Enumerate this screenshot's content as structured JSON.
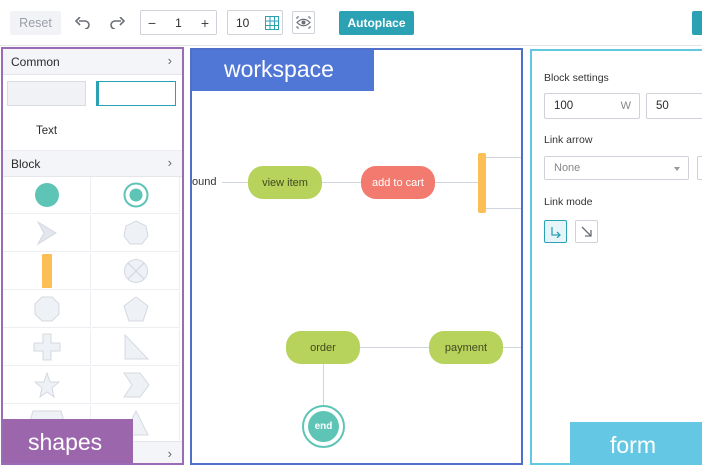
{
  "toolbar": {
    "reset_label": "Reset",
    "undo_icon": "undo-icon",
    "redo_icon": "redo-icon",
    "scale_minus": "−",
    "scale_value": "1",
    "scale_plus": "+",
    "grid_value": "10",
    "grid_icon": "grid-icon",
    "preview_icon": "eye-icon",
    "autoplace_label": "Autoplace"
  },
  "shapes_panel": {
    "tag": "shapes",
    "common_header": "Common",
    "text_item": "Text",
    "block_header": "Block",
    "chevron": "›"
  },
  "workspace": {
    "tag": "workspace",
    "nodes": {
      "found": "ound",
      "view_item": "view item",
      "add_to_cart": "add to cart",
      "order": "order",
      "payment": "payment",
      "end": "end"
    }
  },
  "form": {
    "tag": "form",
    "block_settings_label": "Block settings",
    "width_value": "100",
    "width_suffix": "W",
    "height_value": "50",
    "link_arrow_label": "Link arrow",
    "link_arrow_value": "None",
    "link_mode_label": "Link mode"
  },
  "colors": {
    "accent": "#2aa2b3",
    "shapes_tag": "#9b66ac",
    "workspace_tag": "#5077d6",
    "form_tag": "#64c7e4",
    "node_green": "#b7d35c",
    "node_red": "#f37a6e",
    "node_teal": "#5ec4b6",
    "bar_orange": "#fbbf55"
  }
}
